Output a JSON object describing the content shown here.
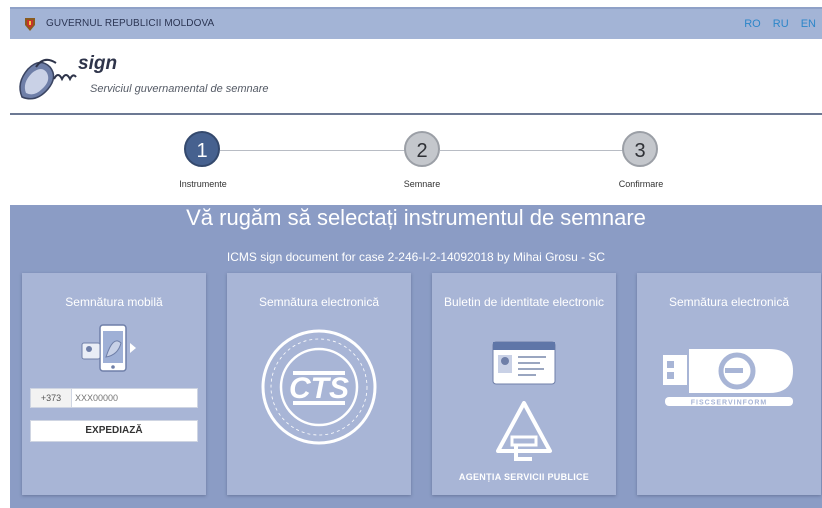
{
  "topbar": {
    "government_title": "GUVERNUL REPUBLICII MOLDOVA",
    "languages": [
      "RO",
      "RU",
      "EN"
    ]
  },
  "header": {
    "brand": "sign",
    "tagline": "Serviciul guvernamental de semnare"
  },
  "steps": [
    {
      "number": "1",
      "label": "Instrumente",
      "active": true
    },
    {
      "number": "2",
      "label": "Semnare",
      "active": false
    },
    {
      "number": "3",
      "label": "Confirmare",
      "active": false
    }
  ],
  "main": {
    "title": "Vă rugăm să selectați instrumentul de semnare",
    "document_title": "ICMS sign document for case 2-246-I-2-14092018 by Mihai Grosu - SC"
  },
  "cards": {
    "mobile": {
      "title": "Semnătura mobilă",
      "phone_prefix": "+373",
      "phone_placeholder": "XXX00000",
      "send_label": "EXPEDIAZĂ"
    },
    "electronic_cts": {
      "title": "Semnătura electronică",
      "seal_text": "CTS"
    },
    "id_card": {
      "title": "Buletin de identitate electronic",
      "agency_label": "AGENȚIA SERVICII PUBLICE"
    },
    "electronic_fisc": {
      "title": "Semnătura electronică",
      "token_text": "FISCSERVINFORM"
    }
  },
  "colors": {
    "topbar": "#a3b4d6",
    "main_background": "#8b9cc5",
    "card_background": "#a8b5d6",
    "active_step": "#46618f",
    "language_link": "#2d86c9"
  }
}
